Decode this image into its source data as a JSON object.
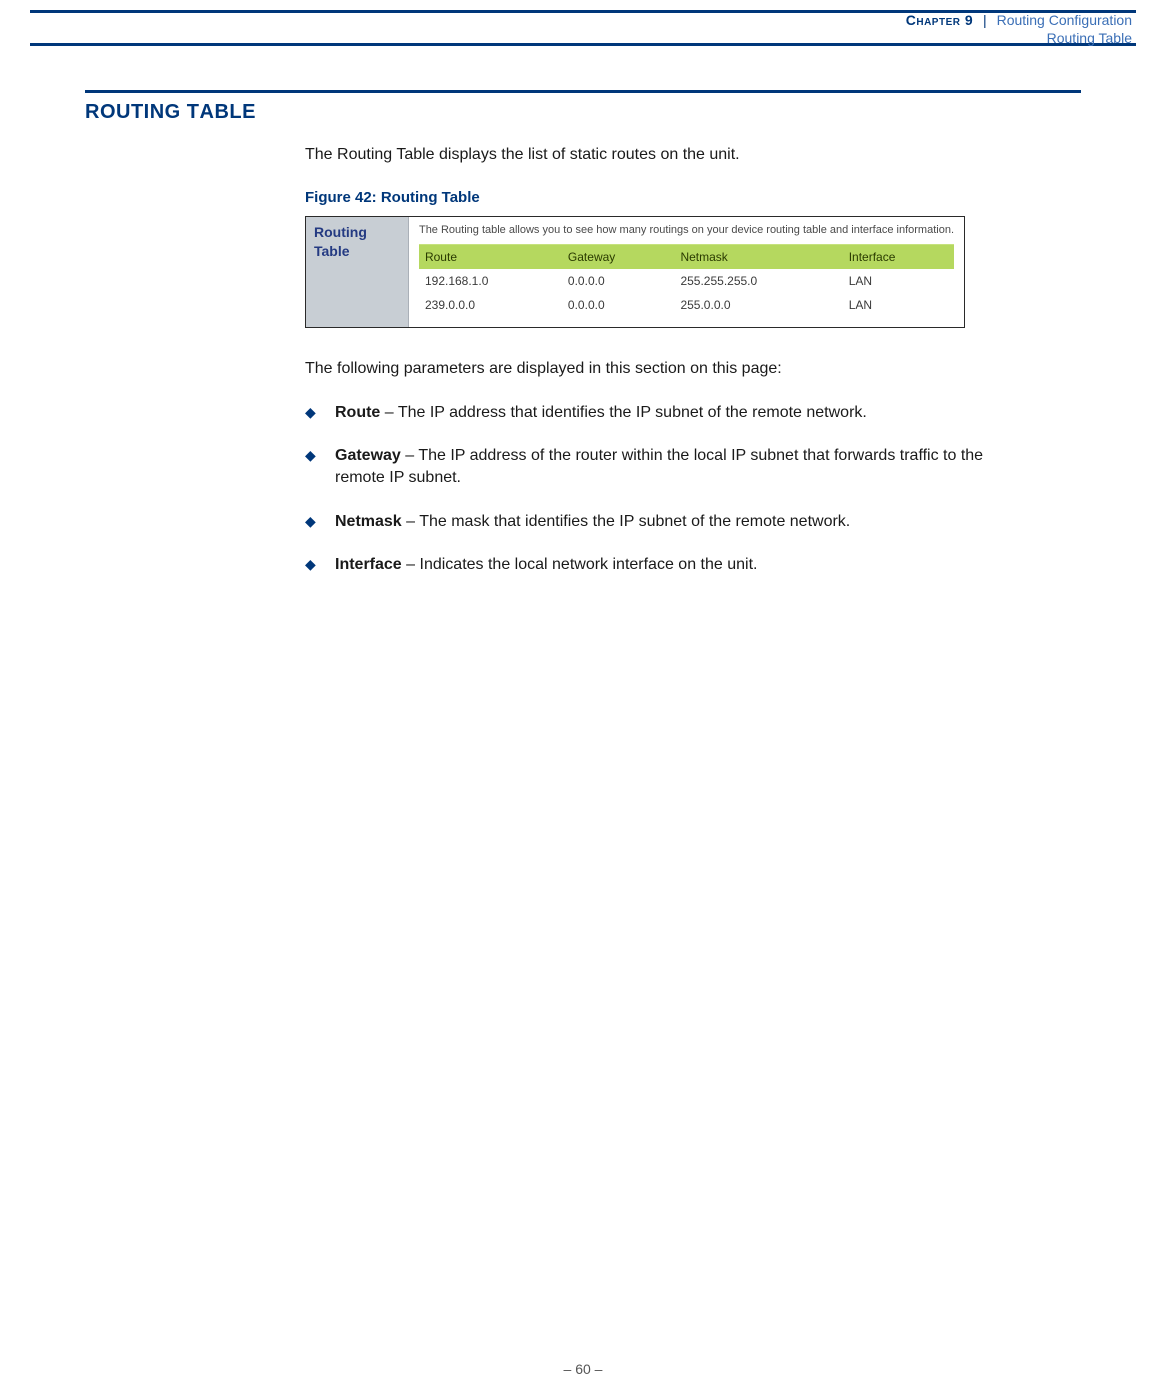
{
  "header": {
    "chapter_label": "Chapter 9",
    "separator": "|",
    "breadcrumb": "Routing Configuration",
    "subtitle": "Routing Table"
  },
  "section": {
    "title_caps": "R",
    "title_rest": "OUTING",
    "title_caps2": "T",
    "title_rest2": "ABLE"
  },
  "intro": "The Routing Table displays the list of static routes on the unit.",
  "figure": {
    "caption": "Figure 42:  Routing Table",
    "side_title": "Routing Table",
    "description": "The Routing table allows you to see how many routings on your device routing table and interface information.",
    "columns": [
      "Route",
      "Gateway",
      "Netmask",
      "Interface"
    ],
    "rows": [
      {
        "route": "192.168.1.0",
        "gateway": "0.0.0.0",
        "netmask": "255.255.255.0",
        "interface": "LAN"
      },
      {
        "route": "239.0.0.0",
        "gateway": "0.0.0.0",
        "netmask": "255.0.0.0",
        "interface": "LAN"
      }
    ]
  },
  "params_intro": "The following parameters are displayed in this section on this page:",
  "params": [
    {
      "term": "Route",
      "desc": " – The IP address that identifies the IP subnet of the remote network."
    },
    {
      "term": "Gateway",
      "desc": " – The IP address of the router within the local IP subnet that forwards traffic to the remote IP subnet."
    },
    {
      "term": "Netmask",
      "desc": " – The mask that identifies the IP subnet of the remote network."
    },
    {
      "term": "Interface",
      "desc": " – Indicates the local network interface on the unit."
    }
  ],
  "footer": {
    "page_marker": "–  60  –"
  },
  "chart_data": {
    "type": "table",
    "title": "Routing Table",
    "columns": [
      "Route",
      "Gateway",
      "Netmask",
      "Interface"
    ],
    "rows": [
      [
        "192.168.1.0",
        "0.0.0.0",
        "255.255.255.0",
        "LAN"
      ],
      [
        "239.0.0.0",
        "0.0.0.0",
        "255.0.0.0",
        "LAN"
      ]
    ]
  }
}
